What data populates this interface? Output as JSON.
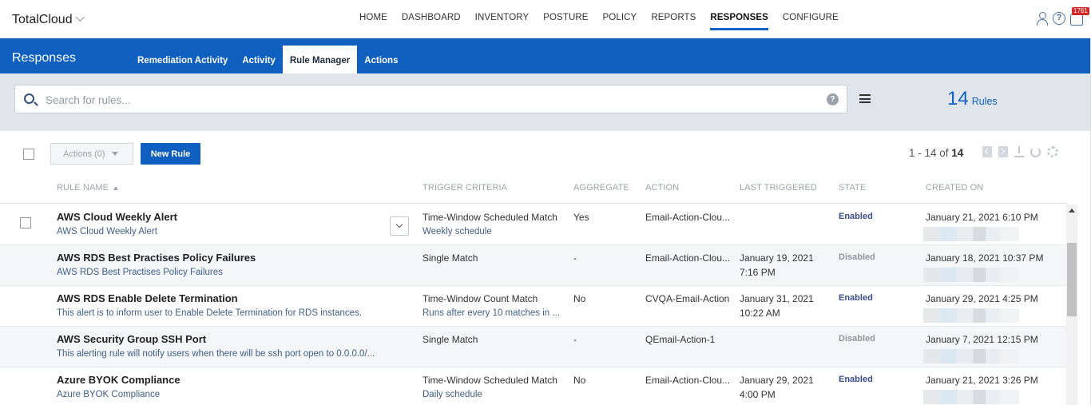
{
  "app": {
    "brand": "TotalCloud",
    "nav": [
      "HOME",
      "DASHBOARD",
      "INVENTORY",
      "POSTURE",
      "POLICY",
      "REPORTS",
      "RESPONSES",
      "CONFIGURE"
    ],
    "active_nav": "RESPONSES",
    "notification_count": "1761"
  },
  "section": {
    "title": "Responses",
    "tabs": [
      "Remediation Activity",
      "Activity",
      "Rule Manager",
      "Actions"
    ],
    "active_tab": "Rule Manager"
  },
  "search": {
    "placeholder": "Search for rules...",
    "help": "?",
    "rule_count": "14",
    "rule_count_label": "Rules"
  },
  "toolbar": {
    "actions_label": "Actions (0)",
    "new_rule_label": "New Rule",
    "pagination_range": "1 - 14 of",
    "pagination_total": "14"
  },
  "table": {
    "columns": [
      "RULE NAME",
      "TRIGGER CRITERIA",
      "AGGREGATE",
      "ACTION",
      "LAST TRIGGERED",
      "STATE",
      "CREATED ON"
    ],
    "rows": [
      {
        "name": "AWS Cloud Weekly Alert",
        "description": "AWS Cloud Weekly Alert",
        "trigger": "Time-Window Scheduled Match",
        "trigger_detail": "Weekly schedule",
        "aggregate": "Yes",
        "action": "Email-Action-Clou...",
        "last_triggered_date": "",
        "last_triggered_time": "",
        "state": "Enabled",
        "created_on": "January 21, 2021 6:10 PM"
      },
      {
        "name": "AWS RDS Best Practises Policy Failures",
        "description": "AWS RDS Best Practises Policy Failures",
        "trigger": "Single Match",
        "trigger_detail": "",
        "aggregate": "-",
        "action": "Email-Action-Clou...",
        "last_triggered_date": "January 19, 2021",
        "last_triggered_time": "7:16 PM",
        "state": "Disabled",
        "created_on": "January 18, 2021 10:37 PM"
      },
      {
        "name": "AWS RDS Enable Delete Termination",
        "description": "This alert is to inform user to Enable Delete Termination for RDS instances.",
        "trigger": "Time-Window Count Match",
        "trigger_detail": "Runs after every 10 matches in ...",
        "aggregate": "No",
        "action": "CVQA-Email-Action",
        "last_triggered_date": "January 31, 2021",
        "last_triggered_time": "10:22 AM",
        "state": "Enabled",
        "created_on": "January 29, 2021 4:25 PM"
      },
      {
        "name": "AWS Security Group SSH Port",
        "description": "This alerting rule will notify users when there will be ssh port open to 0.0.0.0/...",
        "trigger": "Single Match",
        "trigger_detail": "",
        "aggregate": "-",
        "action": "QEmail-Action-1",
        "last_triggered_date": "",
        "last_triggered_time": "",
        "state": "Disabled",
        "created_on": "January 7, 2021 12:15 PM"
      },
      {
        "name": "Azure BYOK Compliance",
        "description": "Azure BYOK Compliance",
        "trigger": "Time-Window Scheduled Match",
        "trigger_detail": "Daily schedule",
        "aggregate": "No",
        "action": "Email-Action-Clou...",
        "last_triggered_date": "January 29, 2021",
        "last_triggered_time": "4:00 PM",
        "state": "Enabled",
        "created_on": "January 21, 2021 3:26 PM"
      }
    ]
  },
  "colors": {
    "brand_blue": "#0e5fc0",
    "enabled": "#3a4f8a",
    "disabled": "#8f979f"
  }
}
